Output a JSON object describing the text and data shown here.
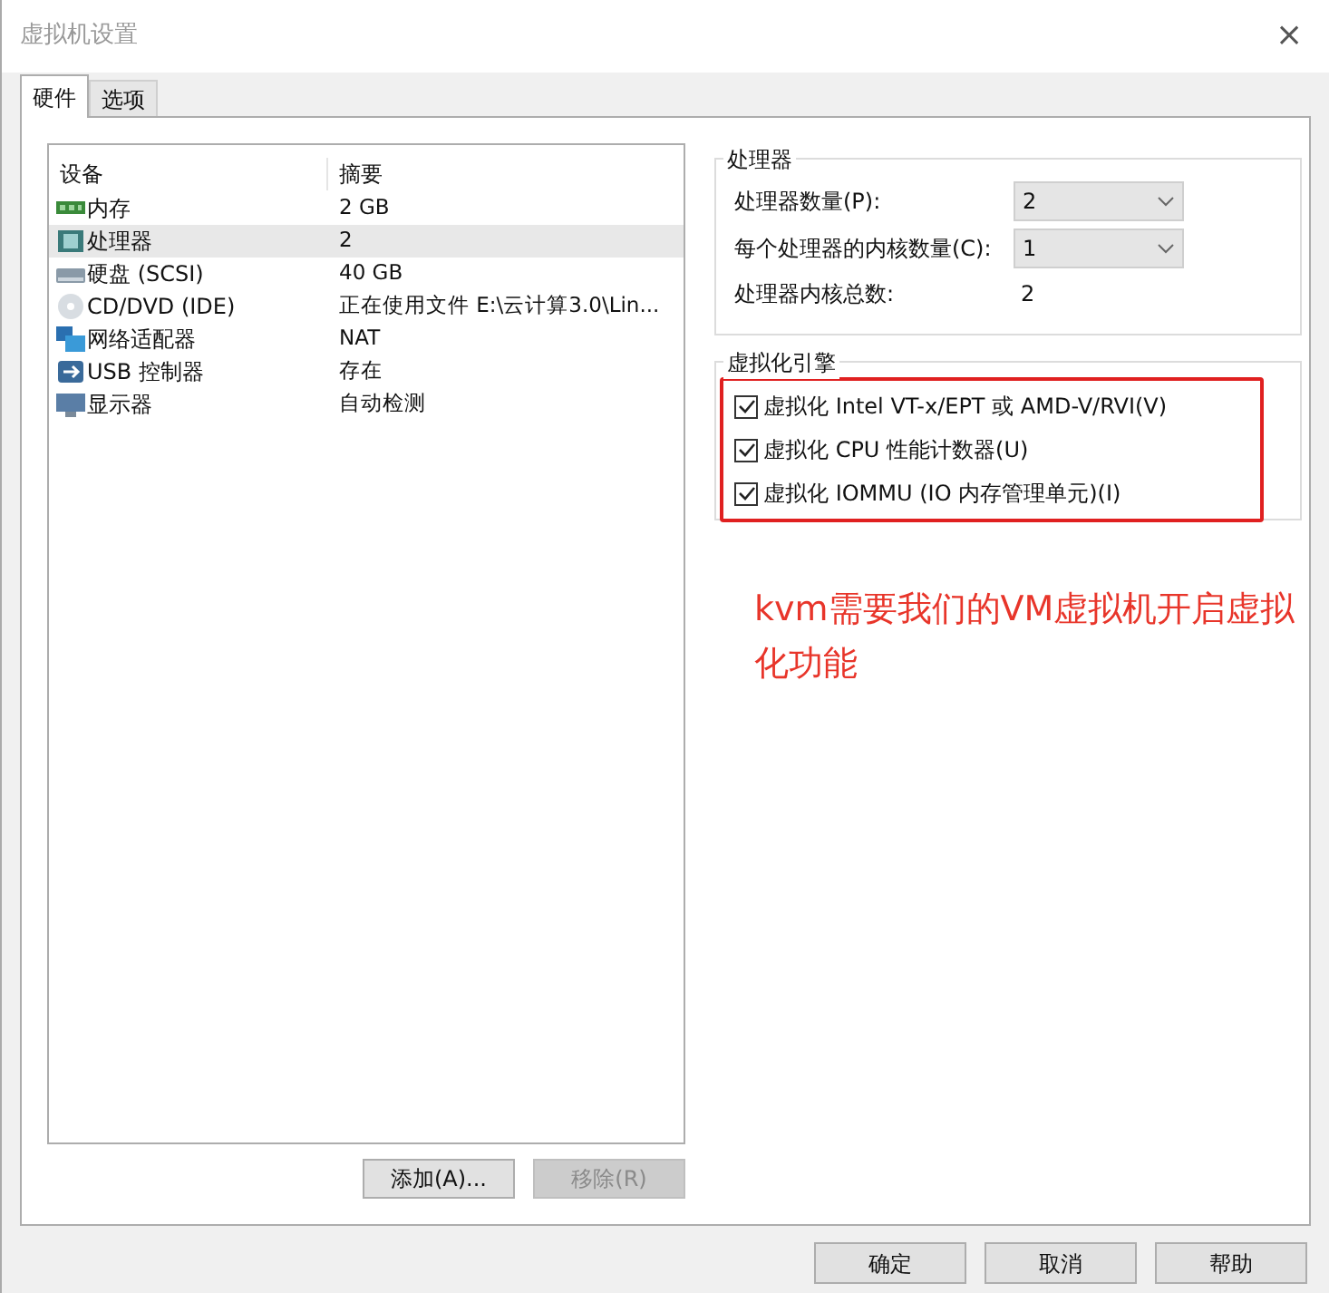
{
  "window": {
    "title": "虚拟机设置",
    "close": "×"
  },
  "tabs": [
    {
      "label": "硬件",
      "selected": true
    },
    {
      "label": "选项",
      "selected": false
    }
  ],
  "devices": {
    "columns": [
      "设备",
      "摘要"
    ],
    "rows": [
      {
        "kind": "memory",
        "device": "内存",
        "summary": "2 GB",
        "selected": false
      },
      {
        "kind": "cpu",
        "device": "处理器",
        "summary": "2",
        "selected": true
      },
      {
        "kind": "disk",
        "device": "硬盘 (SCSI)",
        "summary": "40 GB",
        "selected": false
      },
      {
        "kind": "cd",
        "device": "CD/DVD (IDE)",
        "summary": "正在使用文件 E:\\云计算3.0\\Lin...",
        "selected": false
      },
      {
        "kind": "network",
        "device": "网络适配器",
        "summary": "NAT",
        "selected": false
      },
      {
        "kind": "usb",
        "device": "USB 控制器",
        "summary": "存在",
        "selected": false
      },
      {
        "kind": "display",
        "device": "显示器",
        "summary": "自动检测",
        "selected": false
      }
    ]
  },
  "device_buttons": [
    {
      "label": "添加(A)...",
      "disabled": false
    },
    {
      "label": "移除(R)",
      "disabled": true
    }
  ],
  "processor": {
    "title": "处理器",
    "count_label": "处理器数量(P):",
    "count": "2",
    "cores_label": "每个处理器的内核数量(C):",
    "cores": "1",
    "total_label": "处理器内核总数:",
    "total": "2"
  },
  "virtualization": {
    "title": "虚拟化引擎",
    "options": [
      {
        "label": "虚拟化 Intel VT-x/EPT 或 AMD-V/RVI(V)",
        "checked": true
      },
      {
        "label": "虚拟化 CPU 性能计数器(U)",
        "checked": true
      },
      {
        "label": "虚拟化 IOMMU (IO 内存管理单元)(I)",
        "checked": true
      }
    ]
  },
  "annotation": "kvm需要我们的VM虚拟机开启虚拟化功能",
  "dialog_buttons": [
    "确定",
    "取消",
    "帮助"
  ]
}
